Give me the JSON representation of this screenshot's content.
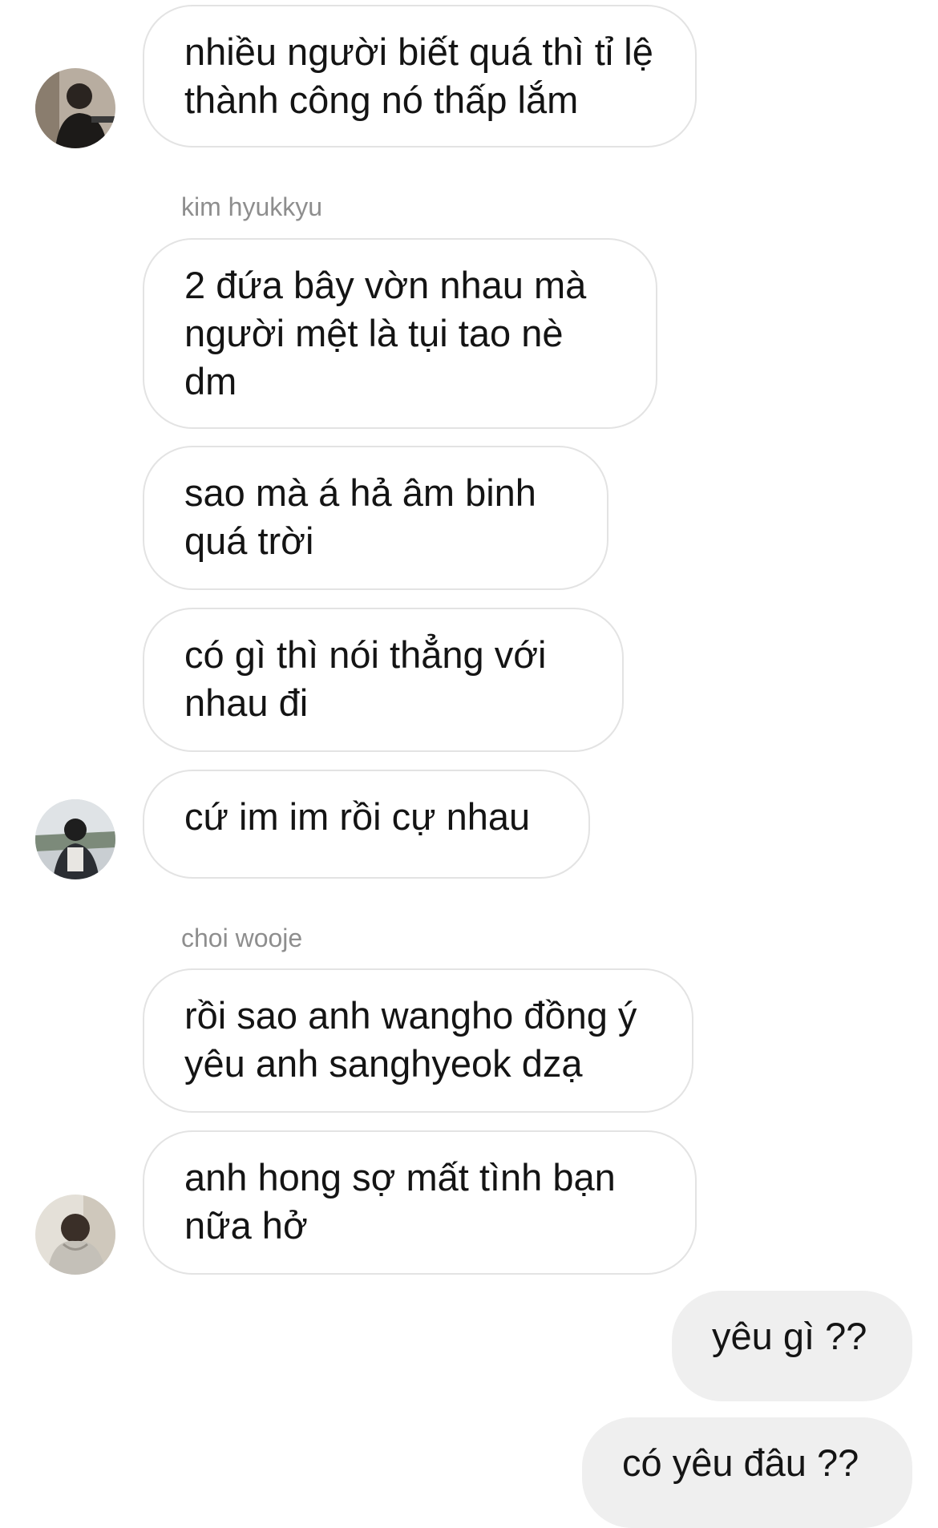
{
  "thread": {
    "messages": [
      {
        "direction": "incoming",
        "text": "nhiều người biết quá thì tỉ lệ thành công nó thấp lắm"
      },
      {
        "direction": "incoming",
        "sender": "kim hyukkyu",
        "text": "2 đứa bây vờn nhau mà người mệt là tụi tao nè dm"
      },
      {
        "direction": "incoming",
        "text": "sao mà á hả âm binh quá trời"
      },
      {
        "direction": "incoming",
        "text": "có gì thì nói thẳng với nhau đi"
      },
      {
        "direction": "incoming",
        "text": "cứ im im rồi cự nhau"
      },
      {
        "direction": "incoming",
        "sender": "choi wooje",
        "text": "rồi sao anh wangho đồng ý yêu anh sanghyeok dzạ"
      },
      {
        "direction": "incoming",
        "text": "anh hong sợ mất tình bạn nữa hở"
      },
      {
        "direction": "outgoing",
        "text": "yêu gì ??"
      },
      {
        "direction": "outgoing",
        "text": "có yêu đâu ??"
      }
    ]
  },
  "colors": {
    "incoming_bubble_border": "#e3e3e3",
    "outgoing_bubble_bg": "#efefef",
    "sender_label": "#8e8e8e",
    "text": "#141414"
  }
}
